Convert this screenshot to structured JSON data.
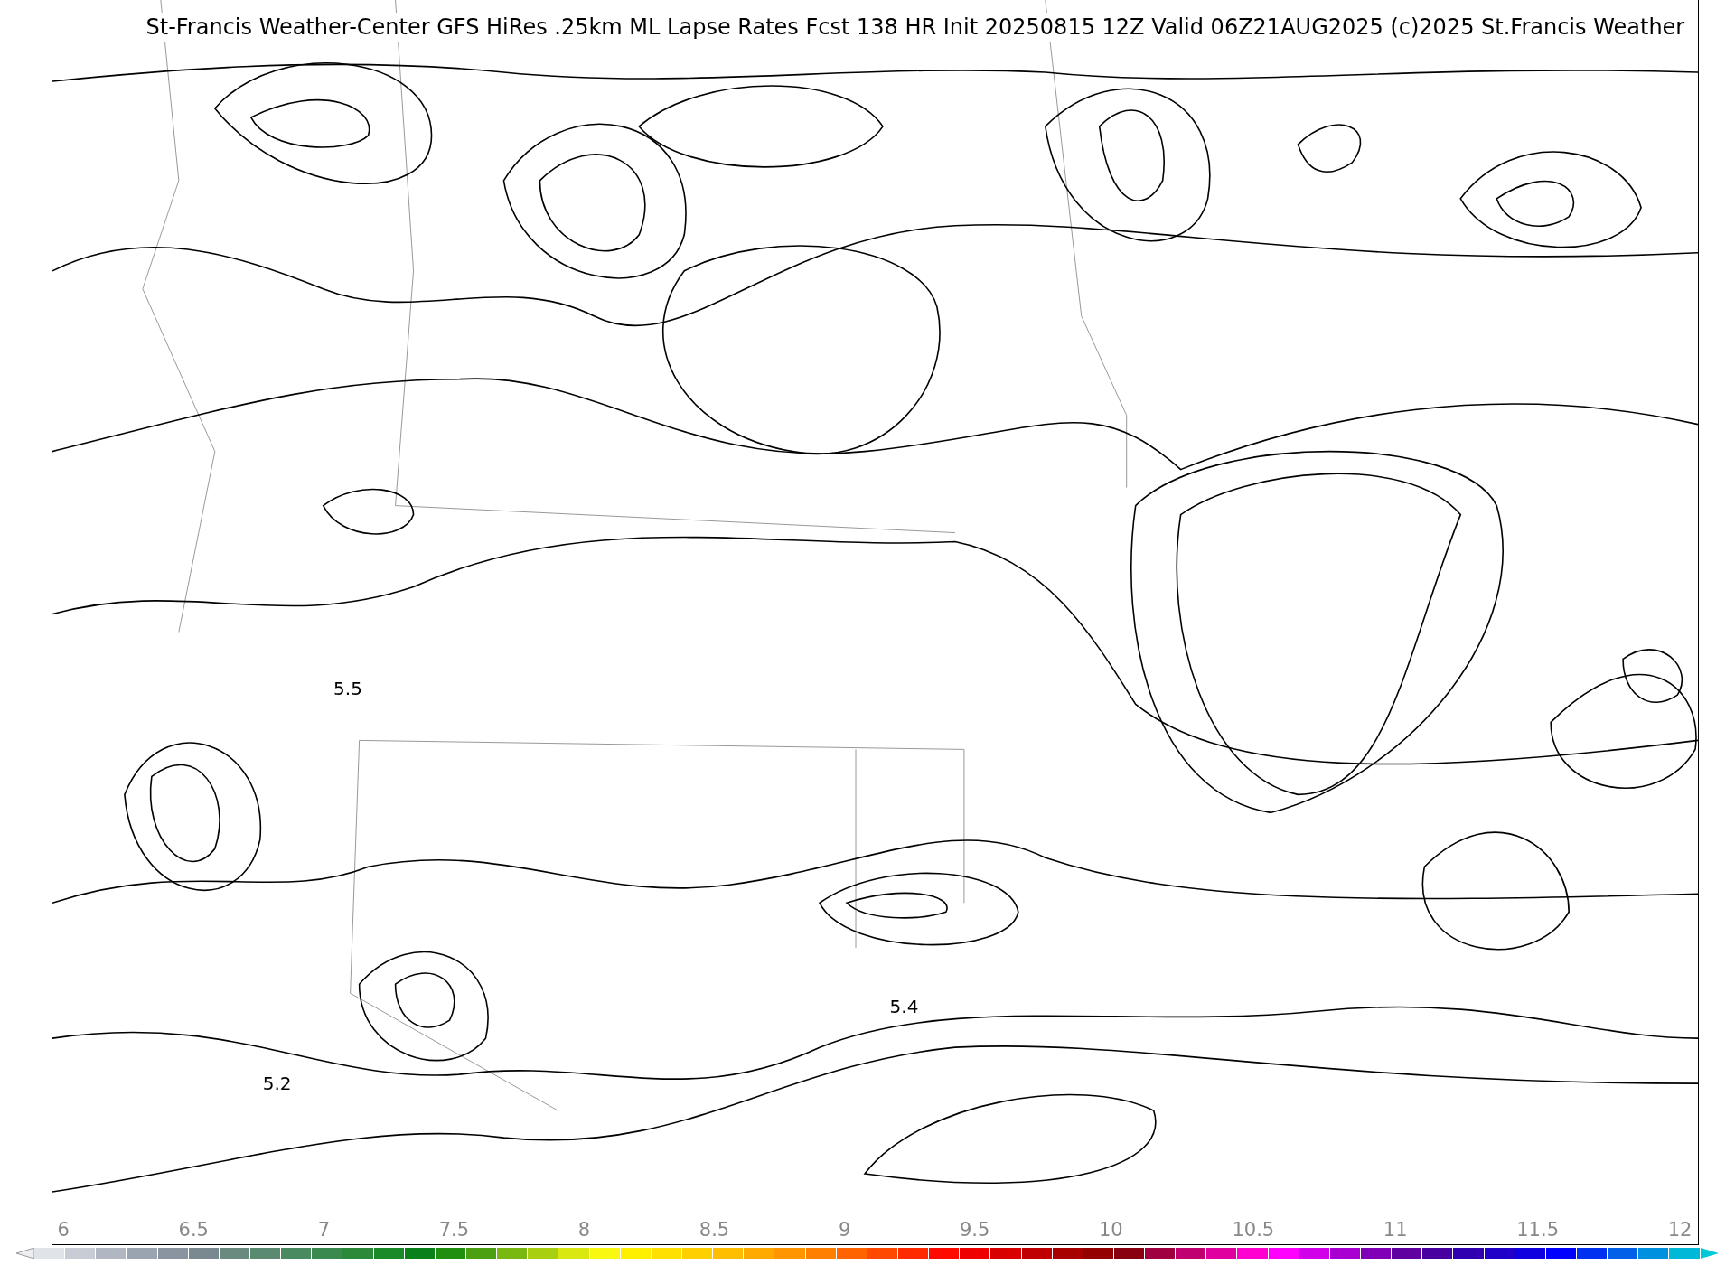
{
  "title": "St-Francis Weather-Center GFS HiRes .25km ML Lapse Rates  Fcst 138 HR Init 20250815 12Z  Valid 06Z21AUG2025    (c)2025 St.Francis Weather",
  "contour_labels": [
    "5.5",
    "5.4",
    "5.2"
  ],
  "colorbar": {
    "ticks": [
      "6",
      "6.5",
      "7",
      "7.5",
      "8",
      "8.5",
      "9",
      "9.5",
      "10",
      "10.5",
      "11",
      "11.5",
      "12"
    ],
    "swatches": [
      {
        "color": "#e0e3e8"
      },
      {
        "color": "#c8ccd4"
      },
      {
        "color": "#b0b7c2"
      },
      {
        "color": "#9aa3b0"
      },
      {
        "color": "#8994a0"
      },
      {
        "color": "#7a8890"
      },
      {
        "color": "#6a8a80"
      },
      {
        "color": "#5a8a70"
      },
      {
        "color": "#4a8a60"
      },
      {
        "color": "#3a8a50"
      },
      {
        "color": "#2a8a3a"
      },
      {
        "color": "#1a8a28"
      },
      {
        "color": "#0a8018"
      },
      {
        "color": "#208f10"
      },
      {
        "color": "#4aa010"
      },
      {
        "color": "#78b810"
      },
      {
        "color": "#a8d010"
      },
      {
        "color": "#d8e810"
      },
      {
        "color": "#f8f810"
      },
      {
        "color": "#fff000"
      },
      {
        "color": "#ffe000"
      },
      {
        "color": "#ffd000"
      },
      {
        "color": "#ffbf00"
      },
      {
        "color": "#ffaa00"
      },
      {
        "color": "#ff9500"
      },
      {
        "color": "#ff7f00"
      },
      {
        "color": "#ff6400"
      },
      {
        "color": "#ff4800"
      },
      {
        "color": "#ff2a00"
      },
      {
        "color": "#ff0a00"
      },
      {
        "color": "#ee0000"
      },
      {
        "color": "#d80000"
      },
      {
        "color": "#c00000"
      },
      {
        "color": "#a80000"
      },
      {
        "color": "#940000"
      },
      {
        "color": "#880010"
      },
      {
        "color": "#a00040"
      },
      {
        "color": "#c00070"
      },
      {
        "color": "#e000a0"
      },
      {
        "color": "#ff00d0"
      },
      {
        "color": "#ff00ff"
      },
      {
        "color": "#d000e8"
      },
      {
        "color": "#a800d0"
      },
      {
        "color": "#8000b8"
      },
      {
        "color": "#6000a0"
      },
      {
        "color": "#4800a0"
      },
      {
        "color": "#3000b0"
      },
      {
        "color": "#2000c8"
      },
      {
        "color": "#1000e0"
      },
      {
        "color": "#0000ff"
      },
      {
        "color": "#0030f0"
      },
      {
        "color": "#0060e8"
      },
      {
        "color": "#0090e0"
      },
      {
        "color": "#00b8d8"
      }
    ]
  }
}
